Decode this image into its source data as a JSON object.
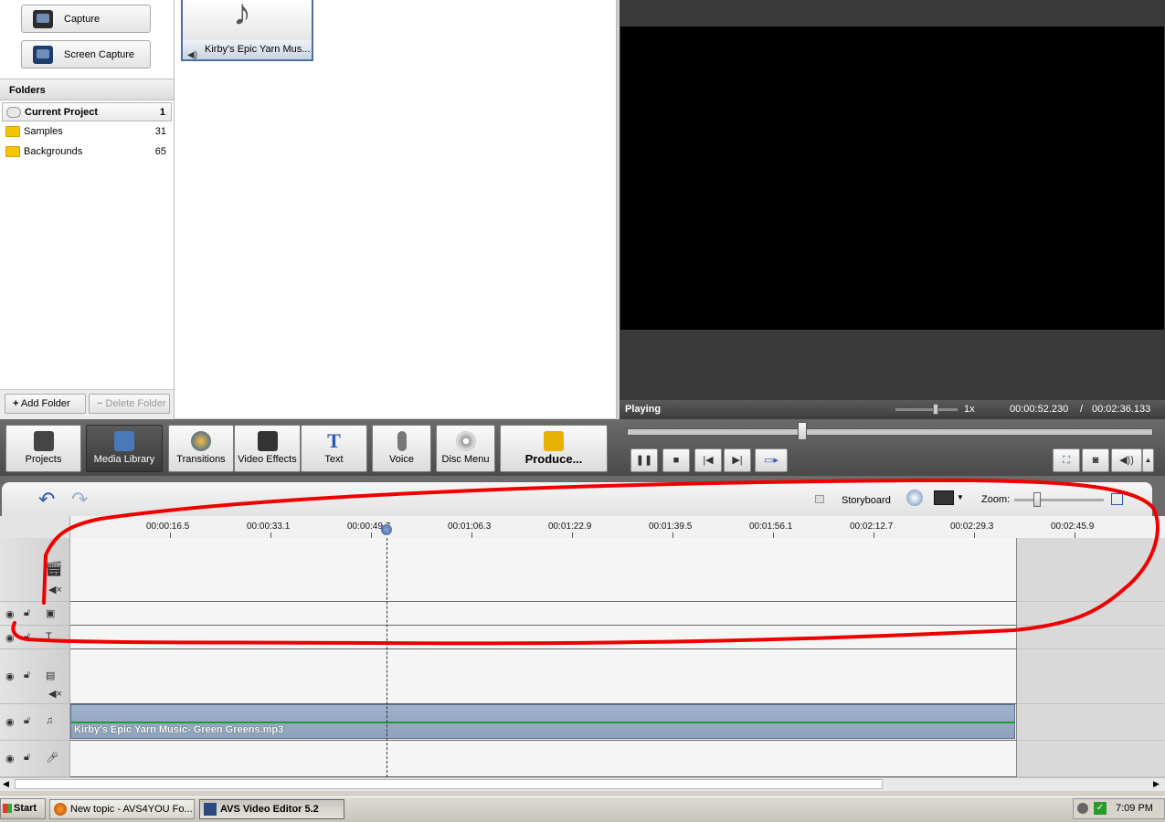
{
  "capture": {
    "capture_label": "Capture",
    "screen_capture_label": "Screen Capture",
    "screen_capture_icon_text": "OREC"
  },
  "folders": {
    "header": "Folders",
    "items": [
      {
        "name": "Current Project",
        "count": "1"
      },
      {
        "name": "Samples",
        "count": "31"
      },
      {
        "name": "Backgrounds",
        "count": "65"
      }
    ],
    "add_folder": "Add Folder",
    "delete_folder": "Delete Folder"
  },
  "media": {
    "items": [
      {
        "label": "Kirby's Epic Yarn Mus..."
      }
    ]
  },
  "preview": {
    "status": "Playing",
    "speed": "1x",
    "current_time": "00:00:52.230",
    "separator": "/",
    "total_time": "00:02:36.133",
    "position_fraction": 0.33
  },
  "toolbar": {
    "projects": "Projects",
    "media_library": "Media Library",
    "transitions": "Transitions",
    "video_effects": "Video Effects",
    "text": "Text",
    "voice": "Voice",
    "disc_menu": "Disc Menu",
    "produce": "Produce..."
  },
  "timeline": {
    "storyboard_label": "Storyboard",
    "zoom_label": "Zoom:",
    "ruler_ticks": [
      "00:00:16.5",
      "00:00:33.1",
      "00:00:49.7",
      "00:01:06.3",
      "00:01:22.9",
      "00:01:39.5",
      "00:01:56.1",
      "00:02:12.7",
      "00:02:29.3",
      "00:02:45.9"
    ],
    "audio_clip_name": "Kirby's Epic Yarn Music- Green Greens.mp3"
  },
  "taskbar": {
    "start": "Start",
    "tasks": [
      {
        "label": "New topic - AVS4YOU Fo...",
        "active": false
      },
      {
        "label": "AVS Video Editor 5.2",
        "active": true
      }
    ],
    "clock": "7:09 PM"
  },
  "colors": {
    "annotation_red": "#ee0000",
    "clip_blue": "#9fb2cc",
    "audio_line_green": "#1e9a2e"
  }
}
